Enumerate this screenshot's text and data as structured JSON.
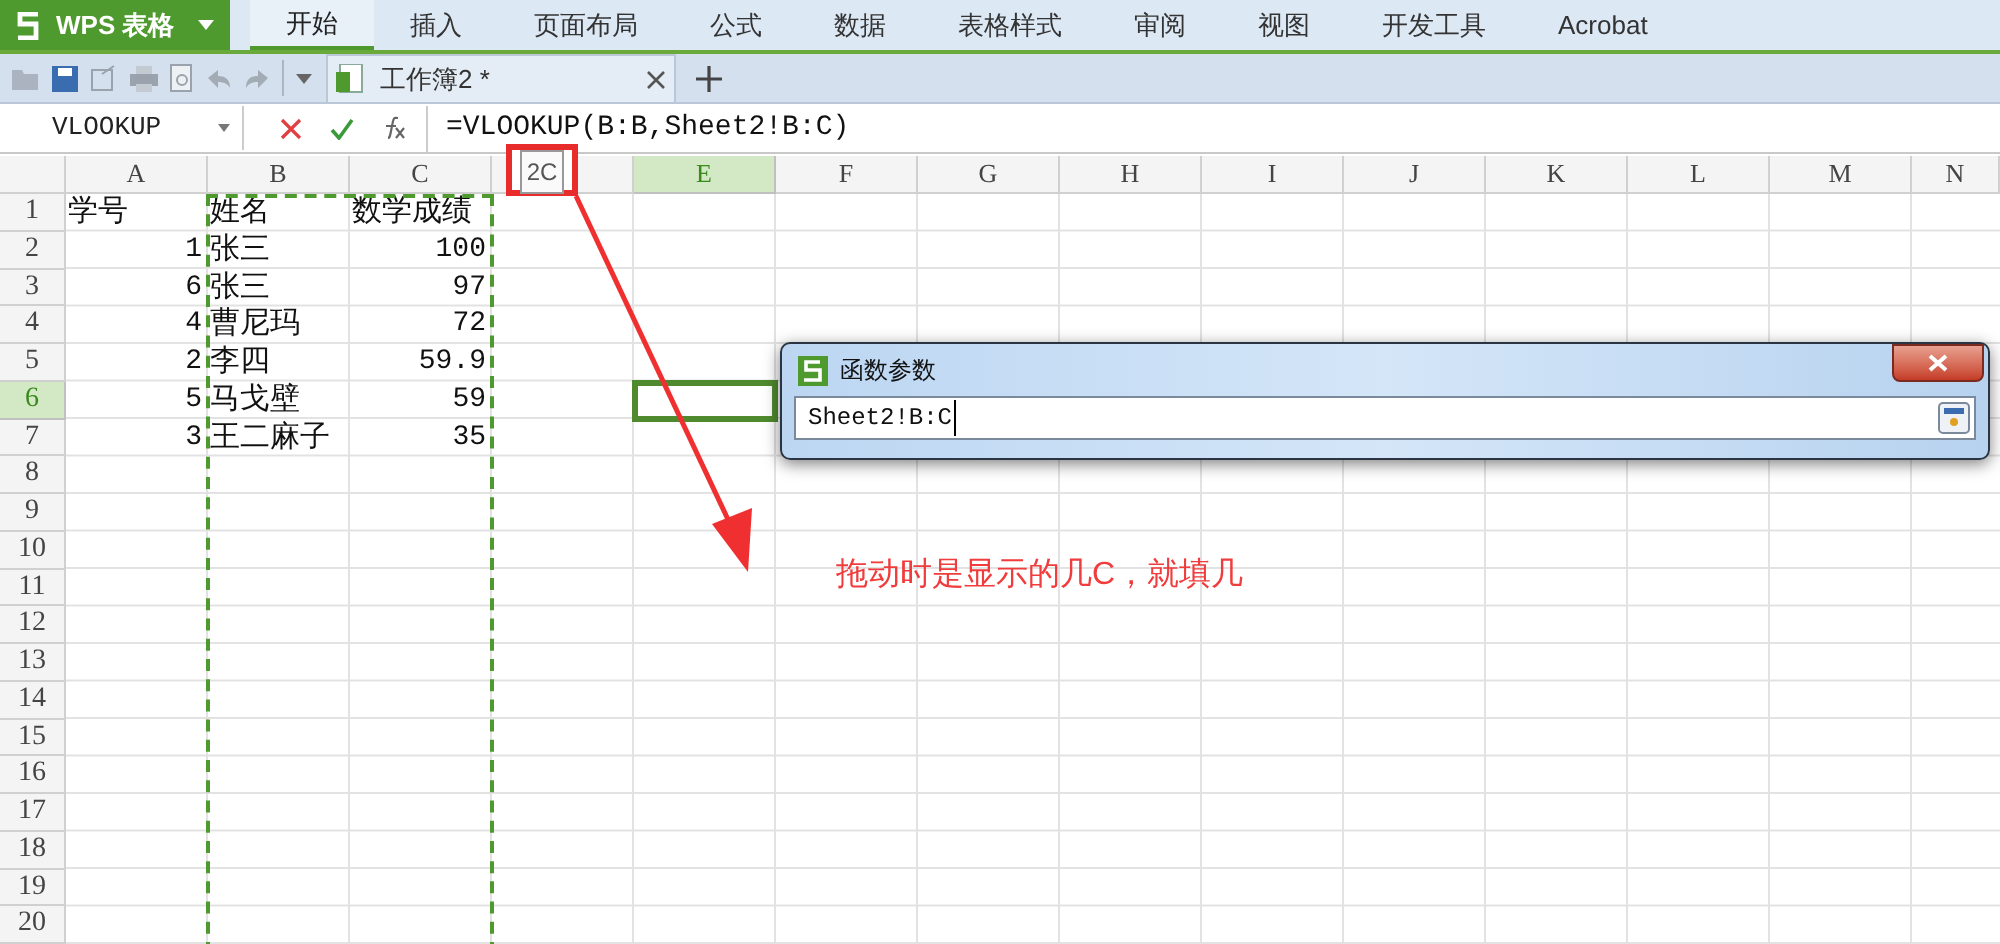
{
  "app_button": {
    "label": "WPS 表格"
  },
  "menu_tabs": [
    {
      "label": "开始",
      "selected": true
    },
    {
      "label": "插入",
      "selected": false
    },
    {
      "label": "页面布局",
      "selected": false
    },
    {
      "label": "公式",
      "selected": false
    },
    {
      "label": "数据",
      "selected": false
    },
    {
      "label": "表格样式",
      "selected": false
    },
    {
      "label": "审阅",
      "selected": false
    },
    {
      "label": "视图",
      "selected": false
    },
    {
      "label": "开发工具",
      "selected": false
    },
    {
      "label": "Acrobat",
      "selected": false
    }
  ],
  "document_tab": {
    "title": "工作簿2 *"
  },
  "formula_bar": {
    "name_box": "VLOOKUP",
    "formula": "=VLOOKUP(B:B,Sheet2!B:C)"
  },
  "drag_tooltip": "2C",
  "columns": [
    {
      "label": "A",
      "selected": false,
      "marquee": false
    },
    {
      "label": "B",
      "selected": false,
      "marquee": true
    },
    {
      "label": "C",
      "selected": false,
      "marquee": true
    },
    {
      "selected": false,
      "marquee": false
    },
    {
      "label": "E",
      "selected": true,
      "marquee": false
    },
    {
      "label": "F",
      "selected": false,
      "marquee": false
    },
    {
      "label": "G",
      "selected": false,
      "marquee": false
    },
    {
      "label": "H",
      "selected": false,
      "marquee": false
    },
    {
      "label": "I",
      "selected": false,
      "marquee": false
    },
    {
      "label": "J",
      "selected": false,
      "marquee": false
    },
    {
      "label": "K",
      "selected": false,
      "marquee": false
    },
    {
      "label": "L",
      "selected": false,
      "marquee": false
    },
    {
      "label": "M",
      "selected": false,
      "marquee": false
    },
    {
      "label": "N",
      "selected": false,
      "marquee": false
    }
  ],
  "rows": [
    {
      "number": "1",
      "selected": false,
      "cells": [
        {
          "text": "学号",
          "kind": "text"
        },
        {
          "text": "姓名",
          "kind": "text"
        },
        {
          "text": "数学成绩",
          "kind": "text"
        }
      ]
    },
    {
      "number": "2",
      "selected": false,
      "cells": [
        {
          "text": "1",
          "kind": "number"
        },
        {
          "text": "张三",
          "kind": "text"
        },
        {
          "text": "100",
          "kind": "number"
        }
      ]
    },
    {
      "number": "3",
      "selected": false,
      "cells": [
        {
          "text": "6",
          "kind": "number"
        },
        {
          "text": "张三",
          "kind": "text"
        },
        {
          "text": "97",
          "kind": "number"
        }
      ]
    },
    {
      "number": "4",
      "selected": false,
      "cells": [
        {
          "text": "4",
          "kind": "number"
        },
        {
          "text": "曹尼玛",
          "kind": "text"
        },
        {
          "text": "72",
          "kind": "number"
        }
      ]
    },
    {
      "number": "5",
      "selected": false,
      "cells": [
        {
          "text": "2",
          "kind": "number"
        },
        {
          "text": "李四",
          "kind": "text"
        },
        {
          "text": "59.9",
          "kind": "number"
        }
      ]
    },
    {
      "number": "6",
      "selected": true,
      "cells": [
        {
          "text": "5",
          "kind": "number"
        },
        {
          "text": "马戈壁",
          "kind": "text"
        },
        {
          "text": "59",
          "kind": "number"
        }
      ]
    },
    {
      "number": "7",
      "selected": false,
      "cells": [
        {
          "text": "3",
          "kind": "number"
        },
        {
          "text": "王二麻子",
          "kind": "text"
        },
        {
          "text": "35",
          "kind": "number"
        }
      ]
    },
    {
      "number": "8",
      "selected": false
    },
    {
      "number": "9",
      "selected": false
    },
    {
      "number": "10",
      "selected": false
    },
    {
      "number": "11",
      "selected": false
    },
    {
      "number": "12",
      "selected": false
    },
    {
      "number": "13",
      "selected": false
    },
    {
      "number": "14",
      "selected": false
    },
    {
      "number": "15",
      "selected": false
    },
    {
      "number": "16",
      "selected": false
    },
    {
      "number": "17",
      "selected": false
    },
    {
      "number": "18",
      "selected": false
    },
    {
      "number": "19",
      "selected": false
    },
    {
      "number": "20",
      "selected": false
    }
  ],
  "dialog": {
    "title": "函数参数",
    "value": "Sheet2!B:C"
  },
  "annotation": "拖动时是显示的几C，就填几"
}
